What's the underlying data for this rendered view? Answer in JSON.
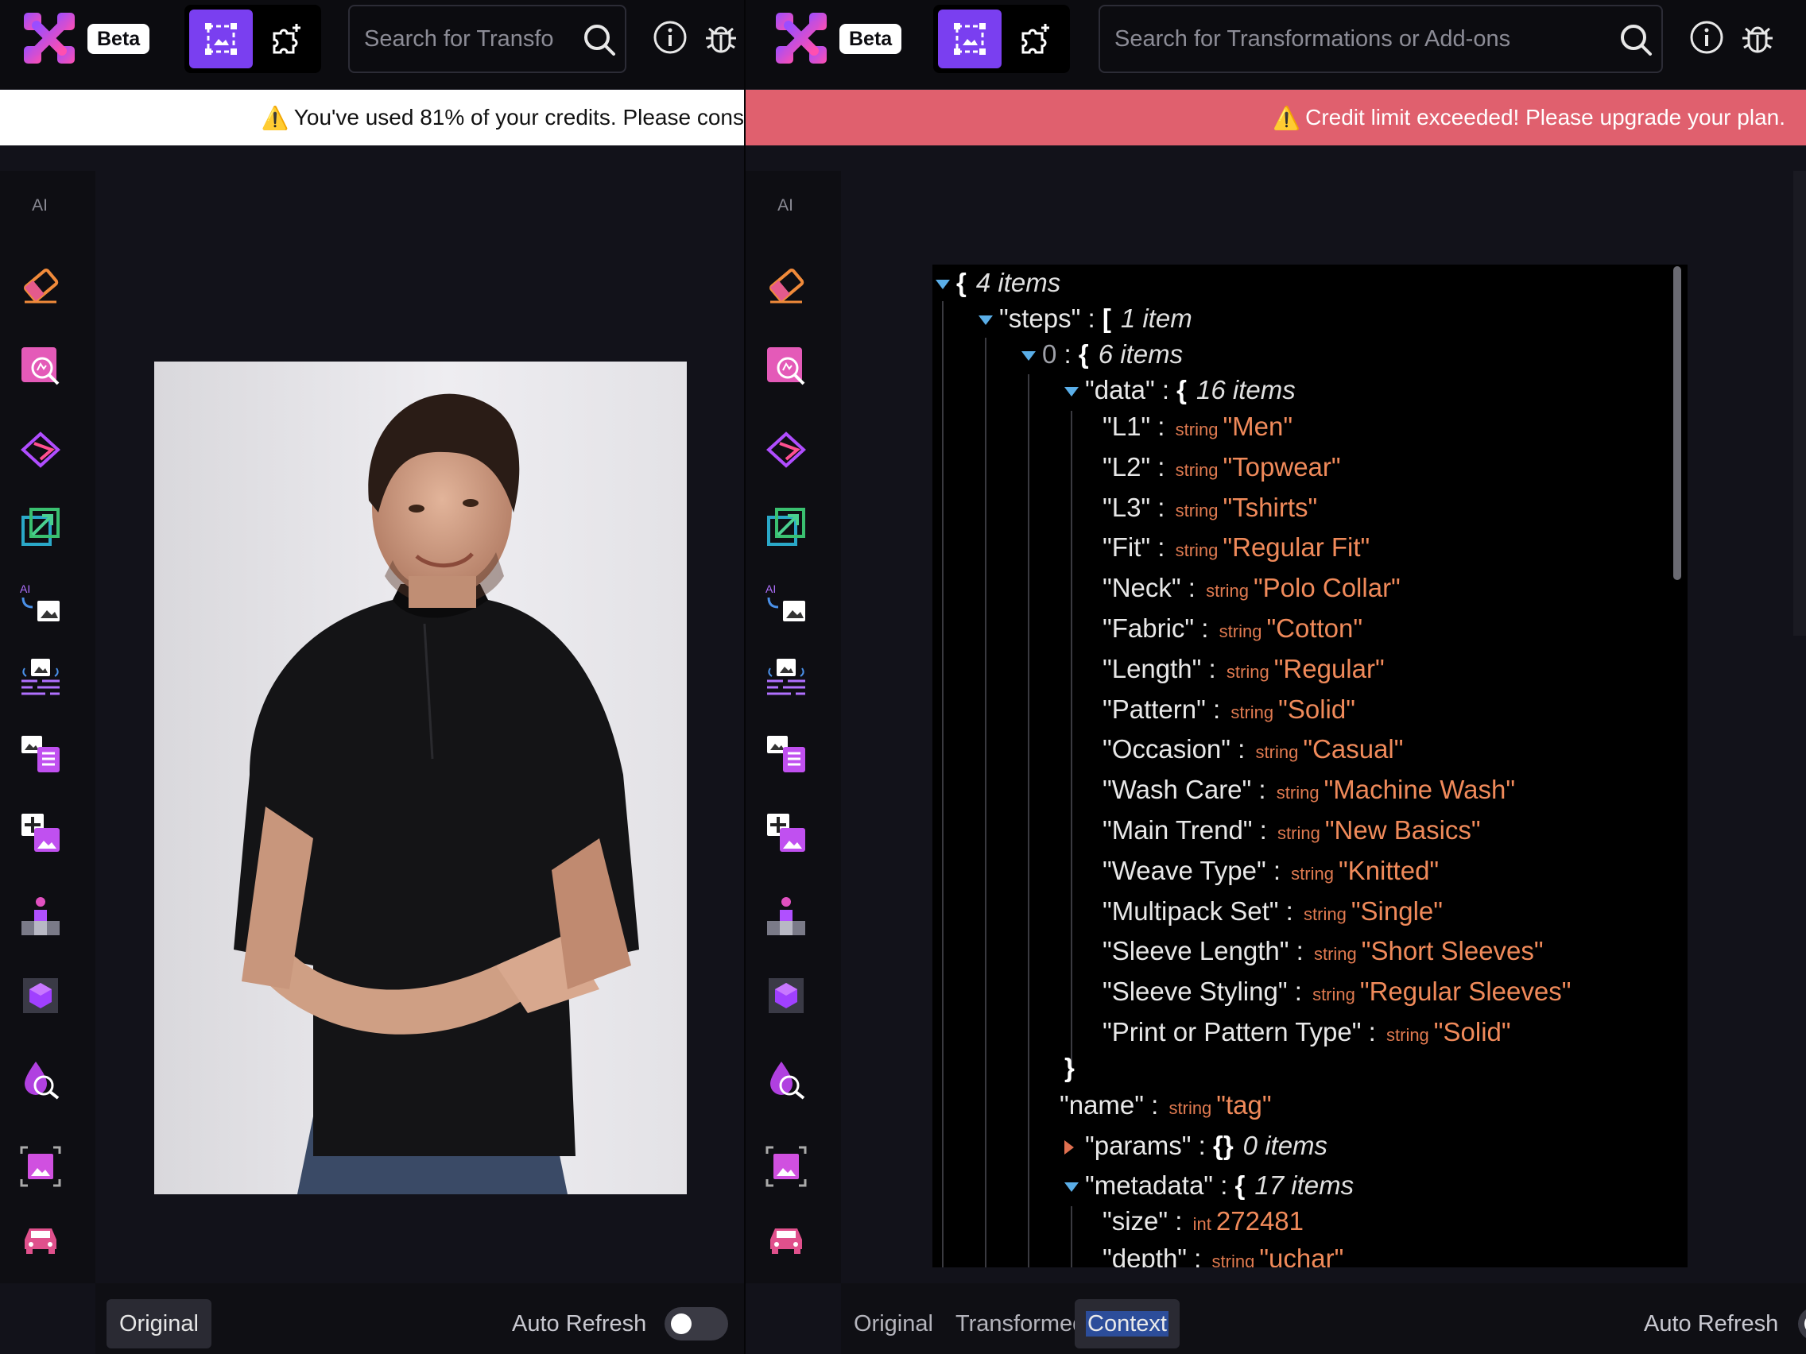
{
  "header": {
    "beta_label": "Beta",
    "search_placeholder_left": "Search for Transfo",
    "search_placeholder_right": "Search for Transformations or Add-ons"
  },
  "banners": {
    "warning": "You've used 81% of your credits. Please cons",
    "error": "Credit limit exceeded! Please upgrade your plan."
  },
  "sidebar": {
    "label": "AI",
    "tools": [
      "eraser-icon",
      "image-search-icon",
      "diamond-layers-icon",
      "resize-export-icon",
      "ai-image-icon",
      "image-text-icon",
      "image-list-icon",
      "add-image-icon",
      "person-stand-icon",
      "cube-icon",
      "drop-search-icon",
      "crop-image-icon",
      "car-icon"
    ]
  },
  "left_bottom": {
    "tab_original": "Original",
    "auto_refresh": "Auto Refresh"
  },
  "right_bottom": {
    "tab_original": "Original",
    "tab_transformed": "Transformed",
    "tab_context": "Context",
    "auto_refresh": "Auto Refresh"
  },
  "json": {
    "root_count": "4 items",
    "steps_key": "\"steps\"",
    "steps_count": "1 item",
    "index0": "0",
    "index0_count": "6 items",
    "data_key": "\"data\"",
    "data_count": "16 items",
    "fields": [
      {
        "key": "\"L1\"",
        "type": "string",
        "value": "\"Men\""
      },
      {
        "key": "\"L2\"",
        "type": "string",
        "value": "\"Topwear\""
      },
      {
        "key": "\"L3\"",
        "type": "string",
        "value": "\"Tshirts\""
      },
      {
        "key": "\"Fit\"",
        "type": "string",
        "value": "\"Regular Fit\""
      },
      {
        "key": "\"Neck\"",
        "type": "string",
        "value": "\"Polo Collar\""
      },
      {
        "key": "\"Fabric\"",
        "type": "string",
        "value": "\"Cotton\""
      },
      {
        "key": "\"Length\"",
        "type": "string",
        "value": "\"Regular\""
      },
      {
        "key": "\"Pattern\"",
        "type": "string",
        "value": "\"Solid\""
      },
      {
        "key": "\"Occasion\"",
        "type": "string",
        "value": "\"Casual\""
      },
      {
        "key": "\"Wash Care\"",
        "type": "string",
        "value": "\"Machine Wash\""
      },
      {
        "key": "\"Main Trend\"",
        "type": "string",
        "value": "\"New Basics\""
      },
      {
        "key": "\"Weave Type\"",
        "type": "string",
        "value": "\"Knitted\""
      },
      {
        "key": "\"Multipack Set\"",
        "type": "string",
        "value": "\"Single\""
      },
      {
        "key": "\"Sleeve Length\"",
        "type": "string",
        "value": "\"Short Sleeves\""
      },
      {
        "key": "\"Sleeve Styling\"",
        "type": "string",
        "value": "\"Regular Sleeves\""
      },
      {
        "key": "\"Print or Pattern Type\"",
        "type": "string",
        "value": "\"Solid\""
      }
    ],
    "name_key": "\"name\"",
    "name_type": "string",
    "name_value": "\"tag\"",
    "params_key": "\"params\"",
    "params_count": "0 items",
    "metadata_key": "\"metadata\"",
    "metadata_count": "17 items",
    "size_key": "\"size\"",
    "size_type": "int",
    "size_value": "272481",
    "depth_key": "\"depth\"",
    "depth_type": "string",
    "depth_value": "\"uchar\""
  },
  "colors": {
    "accent": "#7a3ff0",
    "error_banner": "#e0606e",
    "json_value": "#f08a5a"
  }
}
